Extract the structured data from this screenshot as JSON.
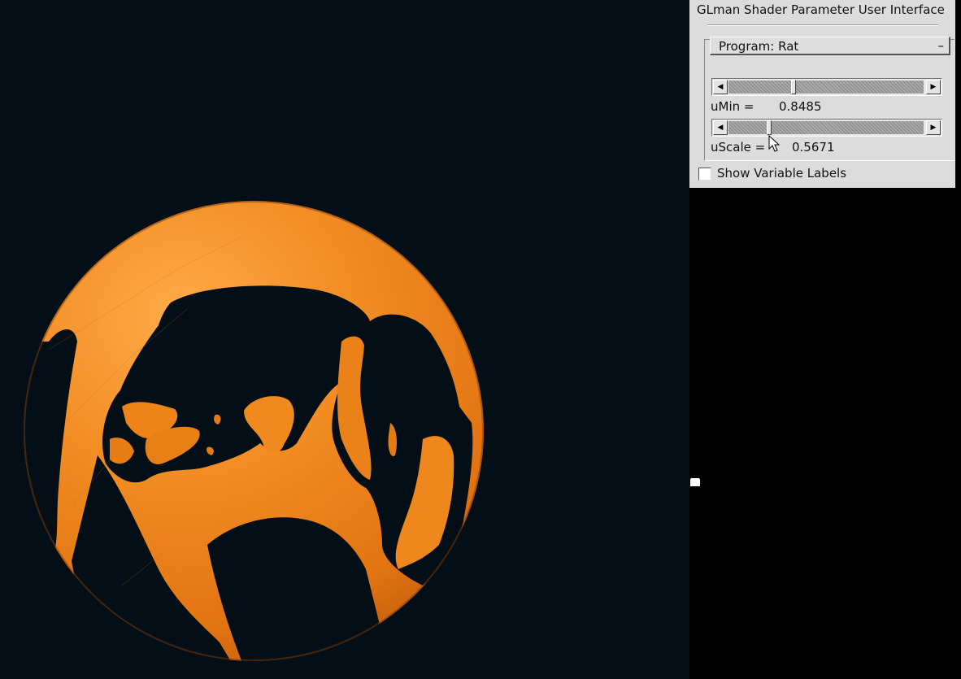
{
  "window": {
    "title": "GLman Shader Parameter User Interface"
  },
  "program": {
    "label": "Program: Rat",
    "toggle": "–"
  },
  "parameters": [
    {
      "name": "uMin =",
      "value": "0.8485",
      "slider_fraction": 0.33
    },
    {
      "name": "uScale =",
      "value": "0.5671",
      "slider_fraction": 0.2
    }
  ],
  "options": {
    "show_labels": "Show Variable Labels",
    "show_labels_checked": false
  },
  "icons": {
    "left_arrow": "arrow-left-icon",
    "right_arrow": "arrow-right-icon",
    "cursor": "mouse-pointer-icon"
  },
  "colors": {
    "viewport_bg": "#040e16",
    "object": "#e07a10",
    "panel_bg": "#dcdcdc"
  }
}
